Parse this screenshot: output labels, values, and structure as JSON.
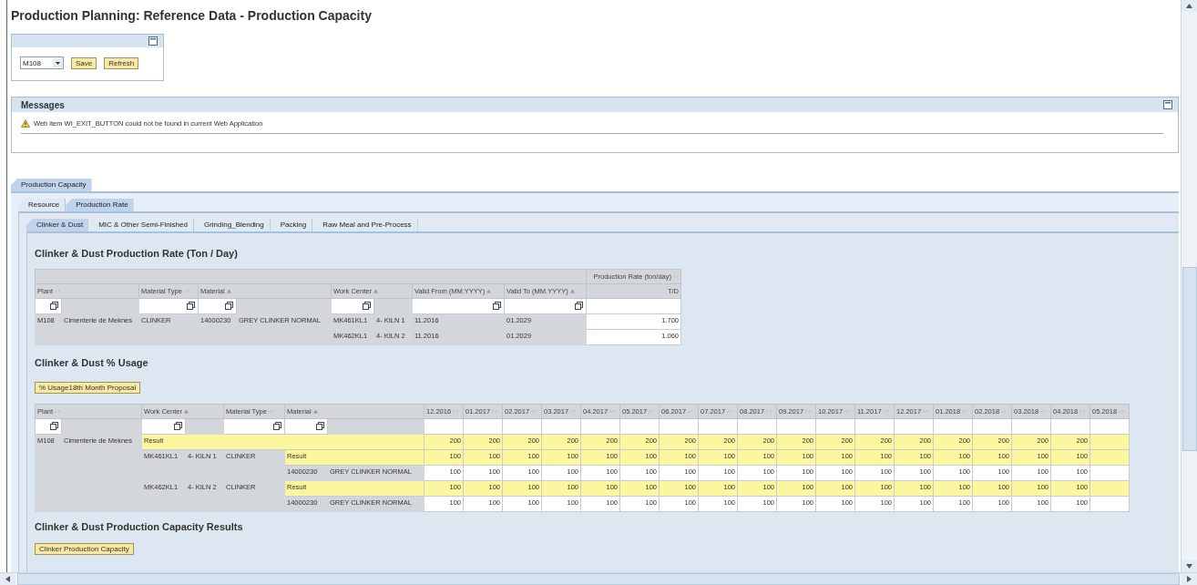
{
  "title": "Production Planning: Reference Data - Production Capacity",
  "selection_panel": {
    "plant": "M108",
    "buttons": [
      "Save",
      "Refresh"
    ]
  },
  "messages": {
    "title": "Messages",
    "items": [
      {
        "kind": "warning",
        "text": "Web item WI_EXIT_BUTTON could not be found in current Web Application"
      }
    ]
  },
  "main_tabs": [
    {
      "label": "Production Capacity",
      "selected": true
    }
  ],
  "sub_tabs": [
    {
      "label": "Resource",
      "selected": false
    },
    {
      "label": "Production Rate",
      "selected": true
    }
  ],
  "category_tabs": [
    {
      "label": "Clinker & Dust",
      "selected": true
    },
    {
      "label": "MIC & Other Semi-Finished",
      "selected": false
    },
    {
      "label": "Grinding_Blending",
      "selected": false
    },
    {
      "label": "Packing",
      "selected": false
    },
    {
      "label": "Raw Meal and Pre-Process",
      "selected": false
    }
  ],
  "rate": {
    "title": "Clinker & Dust Production Rate (Ton / Day)",
    "group_header": "Production Rate (ton/day)",
    "group_sorted": false,
    "columns": [
      {
        "label": "Plant",
        "sorted": false,
        "value_help": true
      },
      {
        "label": "Material Type",
        "sorted": false,
        "value_help": true
      },
      {
        "label": "Material",
        "sorted": true,
        "value_help": true
      },
      {
        "label": "Work Center",
        "sorted": true,
        "value_help": true
      },
      {
        "label": "Valid From (MM.YYYY)",
        "sorted": true,
        "value_help": true
      },
      {
        "label": "Valid To (MM.YYYY)",
        "sorted": true,
        "value_help": true
      },
      {
        "label": "T/D",
        "value_help": false
      }
    ],
    "rows": [
      {
        "plant": "M108",
        "plant_name": "Cimenterie de Meknes",
        "material_type": "CLINKER",
        "material": "14000230",
        "material_name": "GREY CLINKER NORMAL",
        "lines": [
          {
            "work_center": "MK461KL1",
            "work_center_name": "4- KILN 1",
            "valid_from": "11.2016",
            "valid_to": "01.2029",
            "rate": "1.700"
          },
          {
            "work_center": "MK462KL1",
            "work_center_name": "4- KILN 2",
            "valid_from": "11.2016",
            "valid_to": "01.2029",
            "rate": "1.060"
          }
        ]
      }
    ]
  },
  "usage": {
    "title": "Clinker & Dust % Usage",
    "button": "% Usage18th Month Proposal",
    "columns": [
      {
        "label": "Plant",
        "sorted": false
      },
      {
        "label": "Work Center",
        "sorted": true
      },
      {
        "label": "Material Type",
        "sorted": false
      },
      {
        "label": "Material",
        "sorted": true
      }
    ],
    "months": [
      {
        "label": "12.2016",
        "sorted": false
      },
      {
        "label": "01.2017",
        "sorted": false
      },
      {
        "label": "02.2017",
        "sorted": false
      },
      {
        "label": "03.2017",
        "sorted": false
      },
      {
        "label": "04.2017",
        "sorted": false
      },
      {
        "label": "05.2017",
        "sorted": false
      },
      {
        "label": "06.2017",
        "sorted": false
      },
      {
        "label": "07.2017",
        "sorted": false
      },
      {
        "label": "08.2017",
        "sorted": false
      },
      {
        "label": "09.2017",
        "sorted": false
      },
      {
        "label": "10.2017",
        "sorted": false
      },
      {
        "label": "11.2017",
        "sorted": false
      },
      {
        "label": "12.2017",
        "sorted": false
      },
      {
        "label": "01.2018",
        "sorted": false
      },
      {
        "label": "02.2018",
        "sorted": false
      },
      {
        "label": "03.2018",
        "sorted": false
      },
      {
        "label": "04.2018",
        "sorted": false
      },
      {
        "label": "05.2018",
        "sorted": false
      }
    ],
    "plants": [
      {
        "plant": "M108",
        "plant_name": "Cimenterie de Meknes",
        "result_label": "Result",
        "values": [
          "200",
          "200",
          "200",
          "200",
          "200",
          "200",
          "200",
          "200",
          "200",
          "200",
          "200",
          "200",
          "200",
          "200",
          "200",
          "200",
          "200"
        ],
        "work_centers": [
          {
            "work_center": "MK461KL1",
            "work_center_name": "4- KILN 1",
            "material_type": "CLINKER",
            "result_label": "Result",
            "values": [
              "100",
              "100",
              "100",
              "100",
              "100",
              "100",
              "100",
              "100",
              "100",
              "100",
              "100",
              "100",
              "100",
              "100",
              "100",
              "100",
              "100"
            ],
            "materials": [
              {
                "material": "14000230",
                "material_name": "GREY CLINKER NORMAL",
                "values": [
                  "100",
                  "100",
                  "100",
                  "100",
                  "100",
                  "100",
                  "100",
                  "100",
                  "100",
                  "100",
                  "100",
                  "100",
                  "100",
                  "100",
                  "100",
                  "100",
                  "100"
                ]
              }
            ]
          },
          {
            "work_center": "MK462KL1",
            "work_center_name": "4- KILN 2",
            "material_type": "CLINKER",
            "result_label": "Result",
            "values": [
              "100",
              "100",
              "100",
              "100",
              "100",
              "100",
              "100",
              "100",
              "100",
              "100",
              "100",
              "100",
              "100",
              "100",
              "100",
              "100",
              "100"
            ],
            "materials": [
              {
                "material": "14000230",
                "material_name": "GREY CLINKER NORMAL",
                "values": [
                  "100",
                  "100",
                  "100",
                  "100",
                  "100",
                  "100",
                  "100",
                  "100",
                  "100",
                  "100",
                  "100",
                  "100",
                  "100",
                  "100",
                  "100",
                  "100",
                  "100"
                ]
              }
            ]
          }
        ]
      }
    ]
  },
  "results": {
    "title": "Clinker & Dust Production Capacity Results",
    "button": "Clinker Production Capacity"
  }
}
